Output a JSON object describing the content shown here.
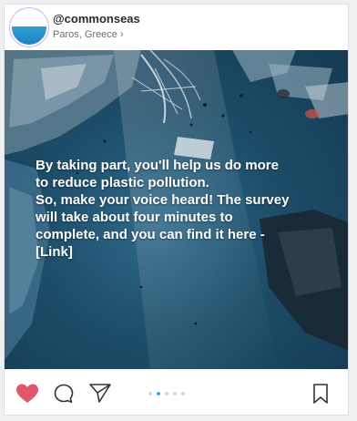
{
  "post": {
    "username": "@commonseas",
    "location": "Paros, Greece",
    "location_chevron": "›",
    "caption_lines": [
      "By taking part, you'll help us do more",
      "to reduce plastic pollution.",
      "So, make your voice heard! The survey",
      "will take about four minutes to",
      "complete, and you can find it here -",
      "[Link]"
    ],
    "carousel": {
      "count": 5,
      "active_index": 1
    },
    "liked": true
  },
  "icons": {
    "like": "heart-icon",
    "comment": "comment-icon",
    "share": "send-icon",
    "save": "bookmark-icon"
  },
  "colors": {
    "like_active": "#e0566a",
    "carousel_active": "#3fa7e0",
    "carousel_inactive": "#cfd8de",
    "icon_stroke": "#333333"
  }
}
